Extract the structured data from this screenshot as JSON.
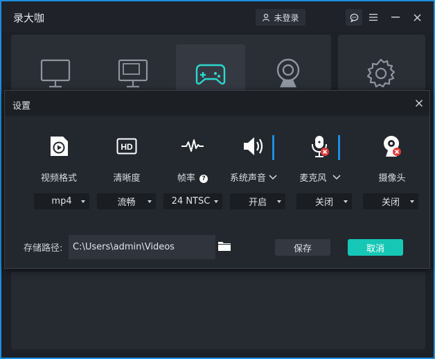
{
  "app": {
    "title": "录大咖",
    "login_label": "未登录"
  },
  "modes": [
    {
      "name": "full-screen-icon"
    },
    {
      "name": "region-icon"
    },
    {
      "name": "game-icon",
      "active": true
    },
    {
      "name": "webcam-icon"
    },
    {
      "name": "settings-gear-icon"
    }
  ],
  "dialog": {
    "title": "设置",
    "columns": [
      {
        "label": "视频格式",
        "value": "mp4",
        "icon": "video-format-icon"
      },
      {
        "label": "清晰度",
        "value": "流畅",
        "icon": "hd-icon"
      },
      {
        "label": "帧率",
        "value": "24 NTSC",
        "icon": "waveform-icon",
        "help": "?"
      },
      {
        "label": "系统声音",
        "value": "开启",
        "icon": "speaker-icon",
        "level": 1.0
      },
      {
        "label": "麦克风",
        "value": "关闭",
        "icon": "microphone-muted-icon",
        "level": 1.0
      },
      {
        "label": "摄像头",
        "value": "关闭",
        "icon": "camera-muted-icon"
      }
    ],
    "path_label": "存储路径:",
    "path_value": "C:\\Users\\admin\\Videos",
    "save_label": "保存",
    "cancel_label": "取消"
  },
  "colors": {
    "accent_blue": "#1a8fe0",
    "accent_teal": "#16c7b5",
    "game_icon": "#2ed8d0",
    "muted_red": "#e23a3a"
  }
}
